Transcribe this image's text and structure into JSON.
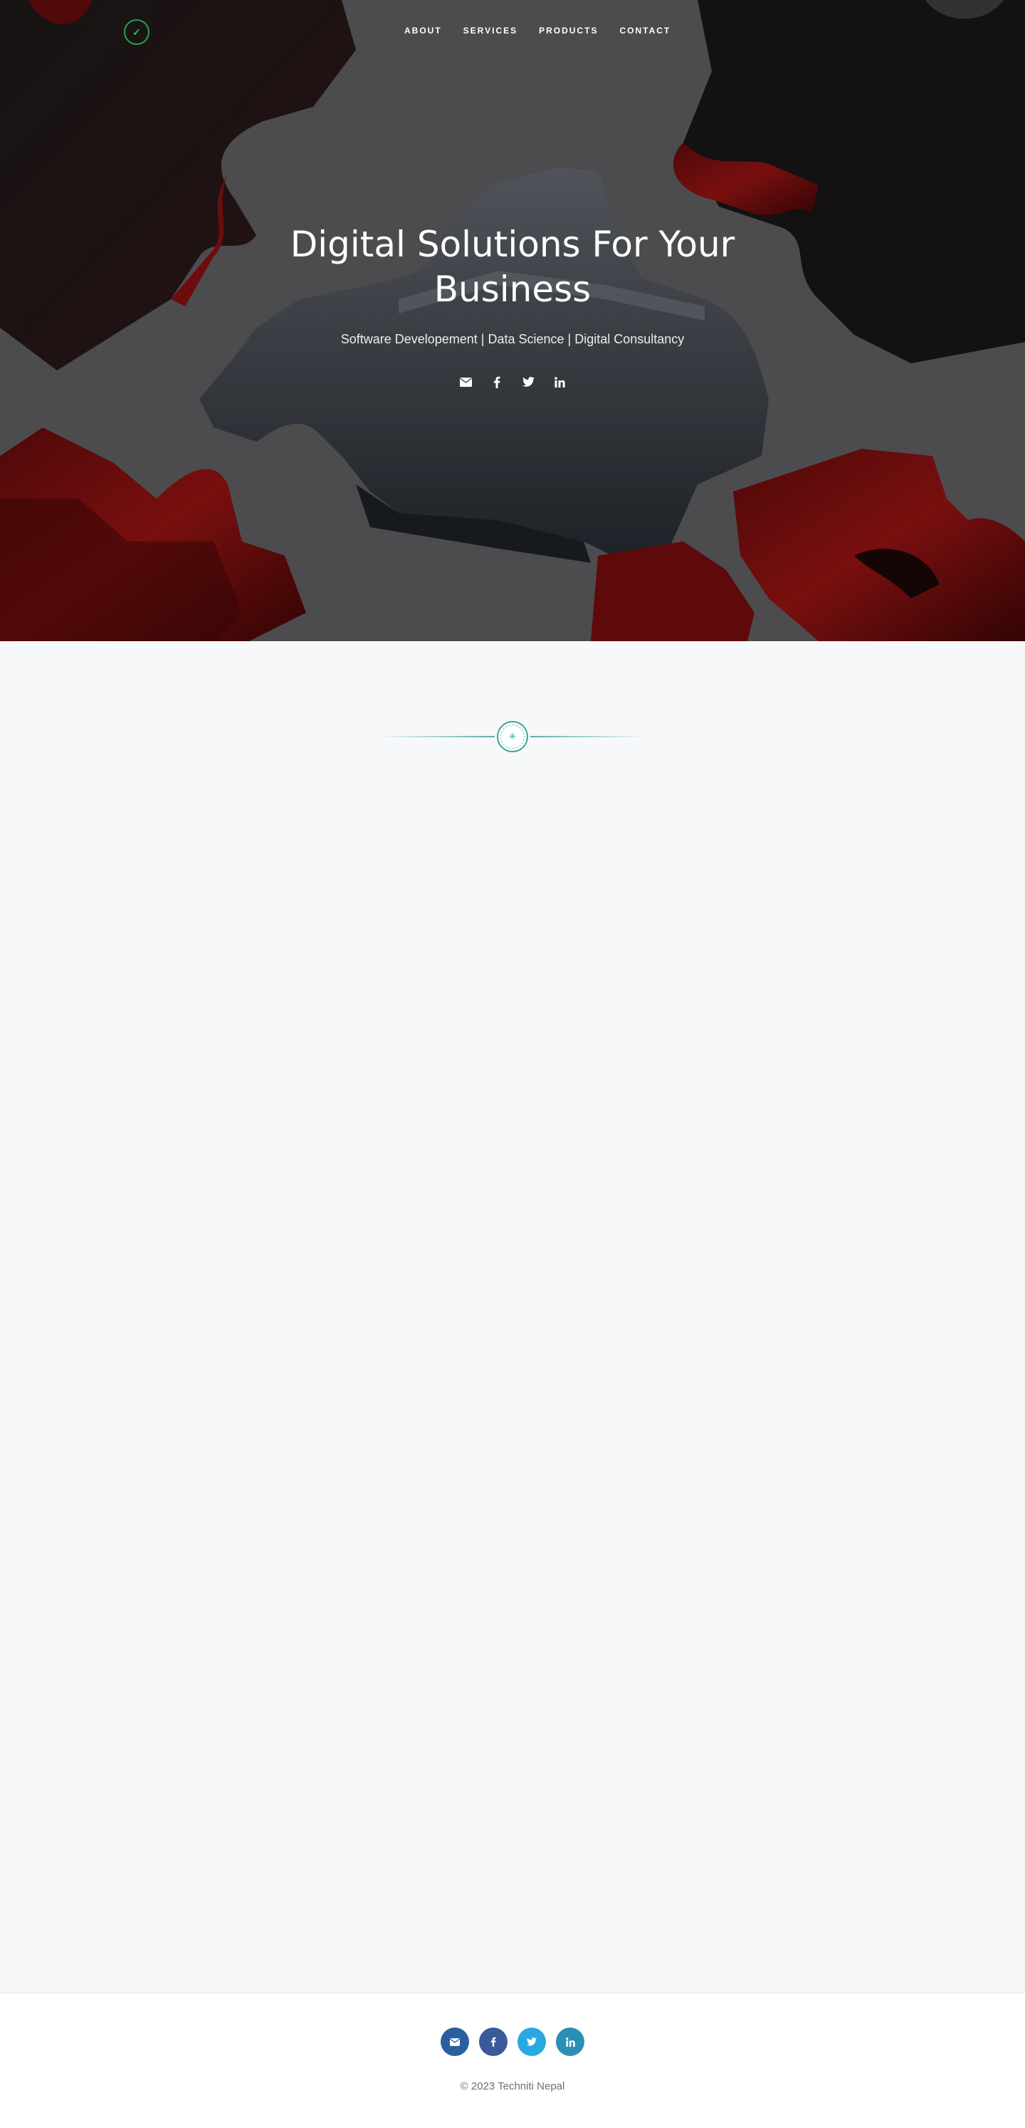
{
  "nav": {
    "logo_icon": "checkmark-icon",
    "links": [
      "ABOUT",
      "SERVICES",
      "PRODUCTS",
      "CONTACT"
    ]
  },
  "hero": {
    "title": "Digital Solutions For Your Business",
    "subtitle": "Software Developement | Data Science | Digital Consultancy",
    "social_icons": [
      "envelope-icon",
      "facebook-icon",
      "twitter-icon",
      "linkedin-icon"
    ]
  },
  "divider": {
    "icon": "asterisk-icon"
  },
  "footer": {
    "social_icons": [
      "envelope-icon",
      "facebook-icon",
      "twitter-icon",
      "linkedin-icon"
    ],
    "social_colors": [
      "#2b5e9e",
      "#3b5a9a",
      "#2aa9e0",
      "#2a8fb5"
    ],
    "copyright": "© 2023 Techniti Nepal"
  }
}
